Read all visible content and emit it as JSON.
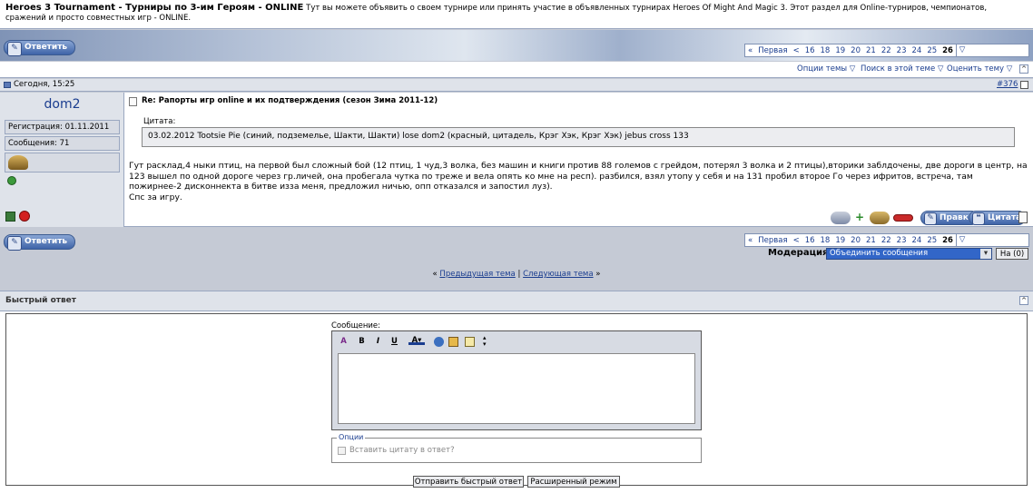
{
  "forum": {
    "title": "Heroes 3 Tournament - Турниры по 3-им Героям - ONLINE",
    "description": "Тут вы можете объявить о своем турнире или принять участие в объявленных турнирах Heroes Of Might And Magic 3. Этот раздел для Online-турниров, чемпионатов, сражений и просто совместных игр - ONLINE."
  },
  "reply_button_label": "Ответить",
  "pager": {
    "first": "Первая",
    "prev": "<",
    "pages": [
      "16",
      "18",
      "19",
      "20",
      "21",
      "22",
      "23",
      "24",
      "25"
    ],
    "current": "26"
  },
  "thread_tools": {
    "options": "Опции темы",
    "search": "Поиск в этой теме",
    "rate": "Оценить тему"
  },
  "post": {
    "date": "Сегодня, 15:25",
    "number": "#376",
    "author": "dom2",
    "registration": "Регистрация: 01.11.2011",
    "messages": "Сообщения: 71",
    "title": "Re: Рапорты игр online и их подтверждения (сезон Зима 2011-12)",
    "quote_label": "Цитата:",
    "quote_text": "03.02.2012 Tootsie Pie (синий, подземелье, Шакти, Шакти) lose dom2 (красный, цитадель, Крэг Хэк, Крэг Хэк) jebus cross 133",
    "body": "Гут расклад,4 ныки птиц, на первой был сложный бой (12 птиц, 1 чуд,3 волка, без машин и книги против 88 големов с грейдом, потерял 3 волка и 2 птицы),вторики заблдочены, две дороги в центр, на 123 вышел по одной дороге через гр.личей, она пробегала чутка по треже и вела опять ко мне на респ). разбился, взял утопу у себя и на 131 пробил второе Го через ифритов, встреча, там пожирнее-2 дисконнекта в битве изза меня, предложил ничью, опп отказался и запостил луз).",
    "body2": "Спс за игру.",
    "edit_label": "Правка",
    "quote_button": "Цитата"
  },
  "moderation": {
    "label": "Модерация",
    "selected": "Объединить сообщения",
    "go": "На (0)"
  },
  "thread_nav": {
    "prev": "Предыдущая тема",
    "sep": "|",
    "next": "Следующая тема"
  },
  "quick_reply": {
    "title": "Быстрый ответ",
    "message_label": "Сообщение:",
    "options_legend": "Опции",
    "quote_checkbox": "Вставить цитату в ответ?",
    "submit": "Отправить быстрый ответ",
    "advanced": "Расширенный режим"
  },
  "colors": {
    "link": "#1a3d8f",
    "panel": "#dfe3ea",
    "background": "#c5cad5",
    "author": "#1a3d8f"
  }
}
